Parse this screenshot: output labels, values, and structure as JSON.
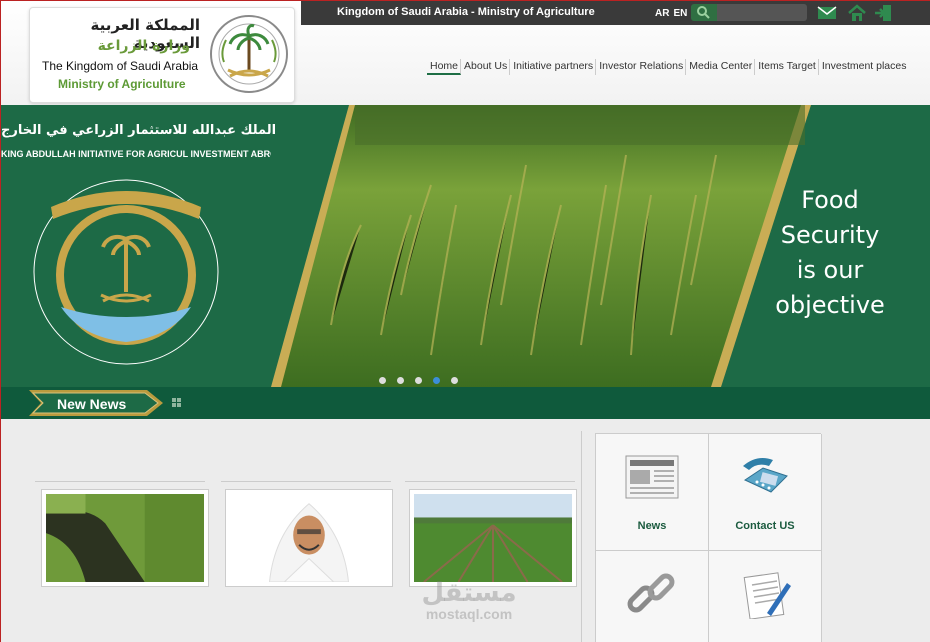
{
  "topbar": {
    "ministry_title": "Kingdom of Saudi Arabia - Ministry of Agriculture",
    "lang_ar": "AR",
    "lang_en": "EN",
    "search_value": ""
  },
  "logo": {
    "title_ar": "المملكة العربية السعودية",
    "subtitle_ar": "وزارة الزراعة",
    "title_en": "The Kingdom of Saudi Arabia",
    "subtitle_en": "Ministry of Agriculture"
  },
  "nav": {
    "items": [
      "Home",
      "About Us",
      "Initiative partners",
      "Investor Relations",
      "Media Center",
      "Items Target",
      "Investment places"
    ]
  },
  "slider": {
    "title_ar": "مبادرة الملك عبدالله للاستثمار الزراعي في الخارج",
    "title_en": "KING ABDULLAH INITIATIVE FOR AGRICUL INVESTMENT ABROAD",
    "slogan_1": "Food",
    "slogan_2": "Security",
    "slogan_3": "is our",
    "slogan_4": "objective",
    "active_dot": 4,
    "dot_count": 5
  },
  "ticker": {
    "label": "New News"
  },
  "tiles": [
    {
      "label": "News",
      "icon": "newspaper-icon"
    },
    {
      "label": "Contact US",
      "icon": "telephone-icon"
    },
    {
      "label": "",
      "icon": "chain-link-icon"
    },
    {
      "label": "",
      "icon": "document-pen-icon"
    }
  ],
  "watermark": {
    "line1": "مستقل",
    "line2": "mostaql.com"
  },
  "colors": {
    "brand_green": "#1d6a46",
    "dark_green": "#0f5a3c",
    "gold": "#b99b3e",
    "topbar": "#3a3a3a"
  }
}
